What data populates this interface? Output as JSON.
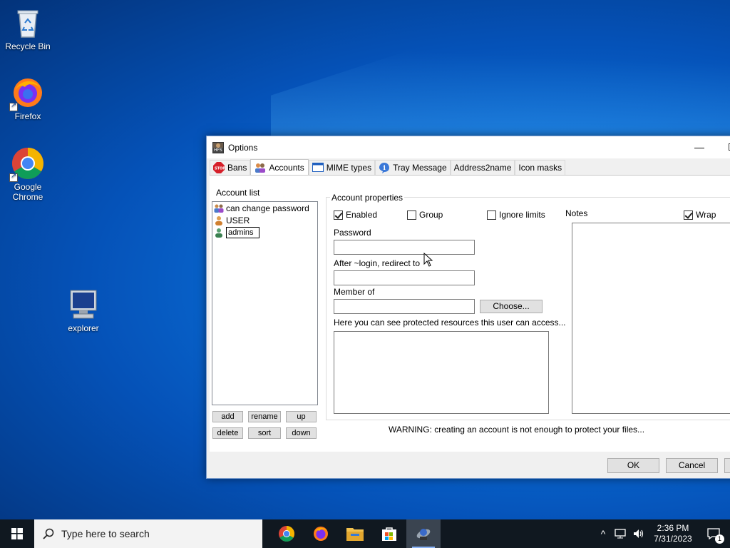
{
  "desktop": {
    "icons": [
      {
        "label": "Recycle Bin"
      },
      {
        "label": "Firefox"
      },
      {
        "label": "Google Chrome"
      },
      {
        "label": "explorer"
      }
    ]
  },
  "window": {
    "title": "Options",
    "controls": {
      "minimize": "—"
    },
    "tabs": [
      {
        "label": "Bans",
        "icon": "stop-icon"
      },
      {
        "label": "Accounts",
        "icon": "users-icon"
      },
      {
        "label": "MIME types",
        "icon": "window-icon"
      },
      {
        "label": "Tray Message",
        "icon": "info-icon"
      },
      {
        "label": "Address2name"
      },
      {
        "label": "Icon masks"
      }
    ],
    "accounts": {
      "list_label": "Account list",
      "items": [
        {
          "label": "can change password",
          "icon": "group-icon"
        },
        {
          "label": "USER",
          "icon": "user-icon"
        },
        {
          "label": "admins",
          "icon": "user-icon",
          "editing": true
        }
      ],
      "buttons": {
        "add": "add",
        "rename": "rename",
        "up": "up",
        "delete": "delete",
        "sort": "sort",
        "down": "down"
      },
      "properties_label": "Account properties",
      "enabled_label": "Enabled",
      "enabled_checked": true,
      "group_label": "Group",
      "group_checked": false,
      "ignore_limits_label": "Ignore limits",
      "ignore_limits_checked": false,
      "password_label": "Password",
      "password_value": "",
      "redirect_label": "After ~login, redirect to",
      "redirect_value": "",
      "member_of_label": "Member of",
      "member_of_value": "",
      "choose_button": "Choose...",
      "resources_label": "Here you can see protected resources this user can access...",
      "notes_label": "Notes",
      "wrap_label": "Wrap",
      "wrap_checked": true,
      "warning": "WARNING: creating an account is not enough to protect  your files..."
    },
    "ok_button": "OK",
    "cancel_button": "Cancel"
  },
  "taskbar": {
    "search_placeholder": "Type here to search",
    "time": "2:36 PM",
    "date": "7/31/2023",
    "notification_count": "1"
  }
}
